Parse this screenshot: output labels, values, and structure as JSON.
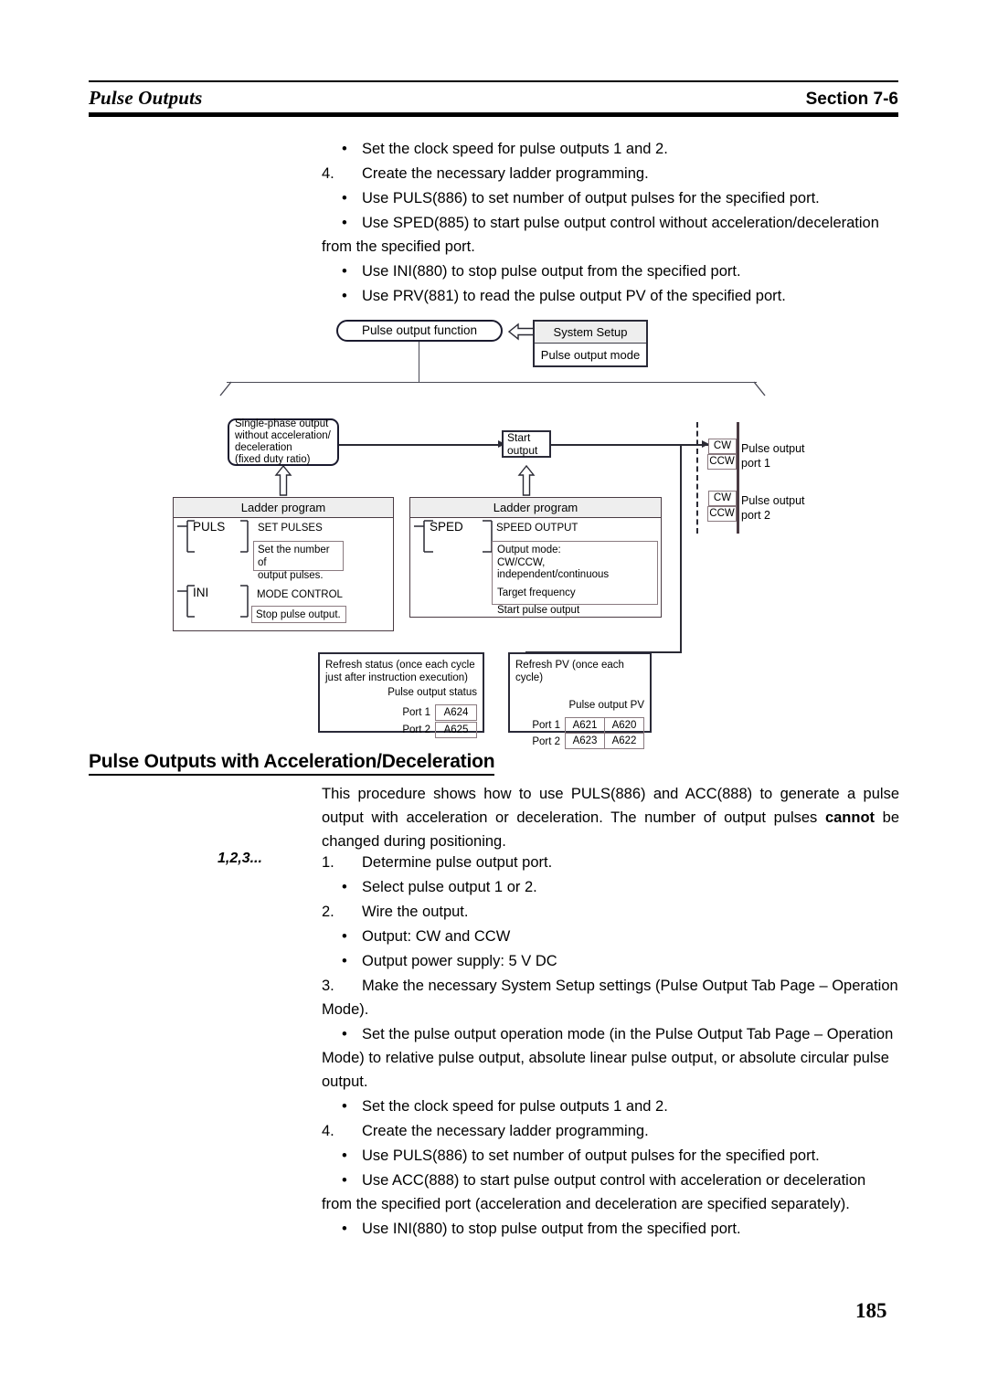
{
  "header": {
    "left_title": "Pulse Outputs",
    "right_title": "Section 7-6"
  },
  "page_number": "185",
  "top_list": {
    "b1": "Set the clock speed for pulse outputs 1 and 2.",
    "n4_marker": "4.",
    "n4": "Create the necessary ladder programming.",
    "b2": "Use PULS(886) to set number of output pulses for the specified port.",
    "b3": "Use SPED(885) to start pulse output control without acceleration/deceleration from the specified port.",
    "b4": "Use INI(880) to stop pulse output from the specified port.",
    "b5": "Use PRV(881) to read the pulse output PV of the specified port.",
    "bullet": "•"
  },
  "diagram": {
    "pulse_output_function": "Pulse output function",
    "system_setup_title": "System Setup",
    "system_setup_row": "Pulse output mode",
    "single_phase": "Single-phase output without acceleration/ deceleration (fixed duty ratio)",
    "single_phase_lines": [
      "Single-phase output",
      "without acceleration/",
      "deceleration",
      "(fixed duty ratio)"
    ],
    "start_output_lines": [
      "Start",
      "output"
    ],
    "ladder_program": "Ladder program",
    "ladder1": {
      "inst1": "PULS",
      "inst1_caption": "SET PULSES",
      "inst1_note_lines": [
        "Set the number of",
        "output pulses."
      ],
      "inst2": "INI",
      "inst2_caption": "MODE CONTROL",
      "inst2_note": "Stop pulse output."
    },
    "ladder2": {
      "inst1": "SPED",
      "inst1_caption": "SPEED OUTPUT",
      "note_lines": [
        "Output mode:",
        "CW/CCW, independent/continuous",
        "Target frequency",
        "Start pulse output"
      ]
    },
    "ports": [
      {
        "cw": "CW",
        "ccw": "CCW",
        "label_lines": [
          "Pulse output",
          "port 1"
        ]
      },
      {
        "cw": "CW",
        "ccw": "CCW",
        "label_lines": [
          "Pulse output",
          "port 2"
        ]
      }
    ],
    "refresh_status": {
      "title_lines": [
        "Refresh status (once each cycle",
        "just after instruction execution)"
      ],
      "subtitle": "Pulse output status",
      "rows": [
        {
          "port": "Port 1",
          "cells": [
            "A624"
          ]
        },
        {
          "port": "Port 2",
          "cells": [
            "A625"
          ]
        }
      ]
    },
    "refresh_pv": {
      "title_lines": [
        "Refresh PV (once each cycle)"
      ],
      "subtitle": "Pulse output PV",
      "rows": [
        {
          "port": "Port 1",
          "cells": [
            "A621",
            "A620"
          ]
        },
        {
          "port": "Port 2",
          "cells": [
            "A623",
            "A622"
          ]
        }
      ]
    }
  },
  "section": {
    "heading": "Pulse Outputs with Acceleration/Deceleration",
    "intro_1": "This procedure shows how to use PULS(886) and ACC(888) to generate a pulse output with acceleration or deceleration. The number of output pulses ",
    "intro_bold": "cannot",
    "intro_2": " be changed during positioning.",
    "numbering_label": "1,2,3...",
    "steps": {
      "s1_marker": "1.",
      "s1": "Determine pulse output port.",
      "s1b1": "Select pulse output 1 or 2.",
      "s2_marker": "2.",
      "s2": "Wire the output.",
      "s2b1": "Output: CW and CCW",
      "s2b2": "Output power supply: 5 V DC",
      "s3_marker": "3.",
      "s3": "Make the necessary System Setup settings (Pulse Output Tab Page – Operation Mode).",
      "s3b1": "Set the pulse output operation mode (in the Pulse Output Tab Page – Operation Mode) to relative pulse output, absolute linear pulse output, or absolute circular pulse output.",
      "s3b2": "Set the clock speed for pulse outputs 1 and 2.",
      "s4_marker": "4.",
      "s4": "Create the necessary ladder programming.",
      "s4b1": "Use PULS(886) to set number of output pulses for the specified port.",
      "s4b2": "Use ACC(888) to start pulse output control with acceleration or deceleration from the specified port (acceleration and deceleration are specified separately).",
      "s4b3": "Use INI(880) to stop pulse output from the specified port."
    }
  }
}
